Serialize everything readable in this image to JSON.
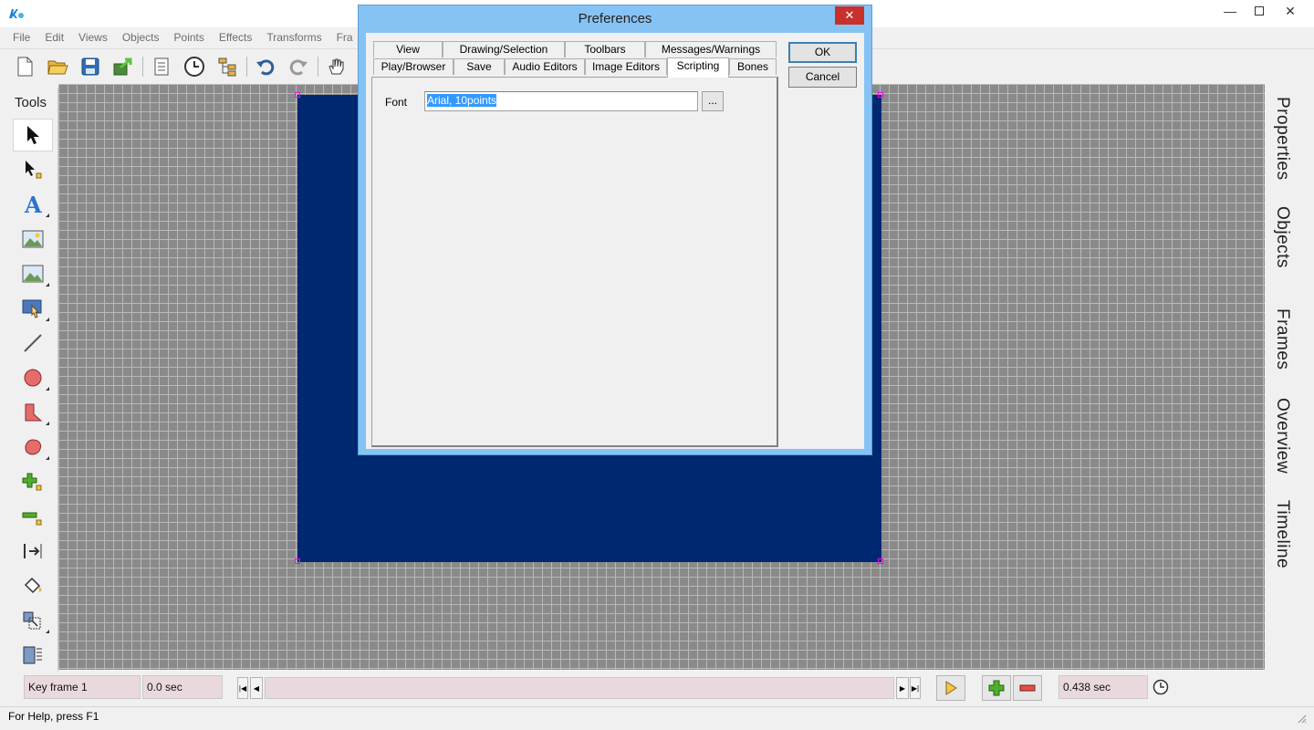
{
  "menu": [
    "File",
    "Edit",
    "Views",
    "Objects",
    "Points",
    "Effects",
    "Transforms",
    "Fra"
  ],
  "tools_panel": {
    "title": "Tools"
  },
  "side_tabs": [
    "Properties",
    "Objects",
    "Frames",
    "Overview",
    "Timeline"
  ],
  "timeline": {
    "frame_label": "Key frame 1",
    "time_value": "0.0 sec",
    "duration_value": "0.438 sec"
  },
  "status": {
    "help_text": "For Help, press F1"
  },
  "dialog": {
    "title": "Preferences",
    "ok_label": "OK",
    "cancel_label": "Cancel",
    "tabs_row1": [
      "View",
      "Drawing/Selection",
      "Toolbars",
      "Messages/Warnings"
    ],
    "tabs_row2": [
      "Play/Browser",
      "Save",
      "Audio Editors",
      "Image Editors",
      "Scripting",
      "Bones"
    ],
    "active_tab": "Scripting",
    "font_label": "Font",
    "font_value": "Arial, 10points",
    "browse_label": "..."
  },
  "colors": {
    "stage": "#002870",
    "dialog_frame": "#86c3f5",
    "close_button": "#c7302b",
    "timeline_field": "#ead9dc",
    "selection": "#3399ff"
  }
}
